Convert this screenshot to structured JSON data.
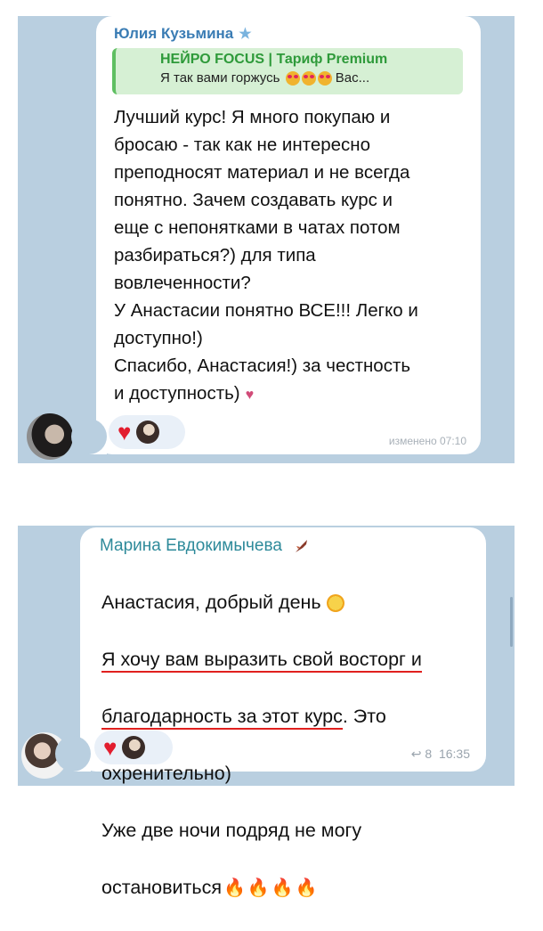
{
  "message1": {
    "sender": "Юлия Кузьмина",
    "reply_title": "НЕЙРО FOCUS | Тариф Premium",
    "reply_text": "Я так вами горжусь",
    "reply_more": "Вас...",
    "text": "Лучший курс! Я много покупаю и\nбросаю - так как не интересно\nпреподносят материал и не всегда\nпонятно. Зачем  создавать курс и\nеще с непонятками в чатах  потом\nразбираться?) для типа\nвовлеченности?\nУ Анастасии понятно ВСЕ!!! Легко и\nдоступно!)\nСпасибо, Анастасия!) за честность\nи доступность)",
    "time": "изменено 07:10",
    "reaction_icon": "heart"
  },
  "message2": {
    "sender": "Марина Евдокимычева",
    "line1": "Анастасия, добрый день",
    "underlined1": "Я хочу вам выразить свой восторг и",
    "underlined2": "благодарность за этот курс",
    "line3_rest": ". Это",
    "line4": "охренительно)",
    "line5": "Уже две ночи подряд не могу",
    "line6": "остановиться",
    "views": "8",
    "time": "16:35",
    "reaction_icon": "heart"
  },
  "colors": {
    "chat_background": "#b9cfe0",
    "bubble": "#ffffff",
    "sender1": "#3a7cb4",
    "sender2": "#2e8a9a",
    "reply_bar": "#5fbf62",
    "underline": "#e0201e"
  }
}
